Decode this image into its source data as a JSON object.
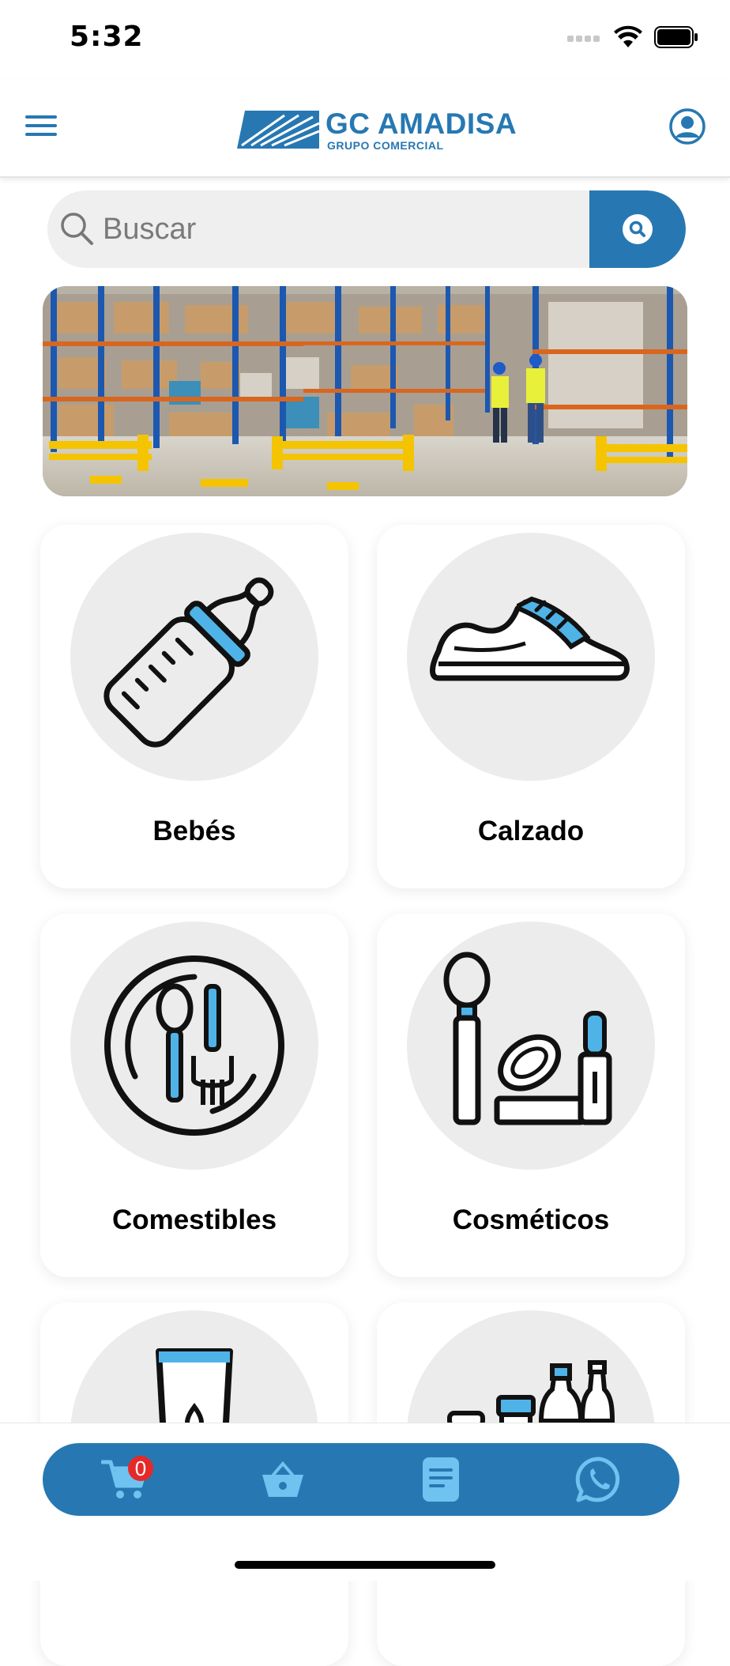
{
  "status_bar": {
    "time": "5:32"
  },
  "header": {
    "logo_title": "GC AMADISA",
    "logo_subtitle": "GRUPO COMERCIAL",
    "menu_icon": "hamburger-menu-icon",
    "profile_icon": "user-circle-icon"
  },
  "search": {
    "placeholder": "Buscar"
  },
  "categories": [
    {
      "label": "Bebés",
      "icon": "baby-bottle-icon"
    },
    {
      "label": "Calzado",
      "icon": "sneaker-icon"
    },
    {
      "label": "Comestibles",
      "icon": "plate-cutlery-icon"
    },
    {
      "label": "Cosméticos",
      "icon": "makeup-icon"
    },
    {
      "label": "",
      "icon": "cream-container-icon"
    },
    {
      "label": "",
      "icon": "bottles-icon"
    }
  ],
  "bottom_nav": {
    "cart_count": "0",
    "items": [
      "cart-icon",
      "basket-icon",
      "document-icon",
      "whatsapp-icon"
    ]
  },
  "colors": {
    "primary": "#2778b2",
    "accent_light": "#4fb3e8",
    "badge": "#e52929",
    "circle_bg": "#ececec"
  }
}
